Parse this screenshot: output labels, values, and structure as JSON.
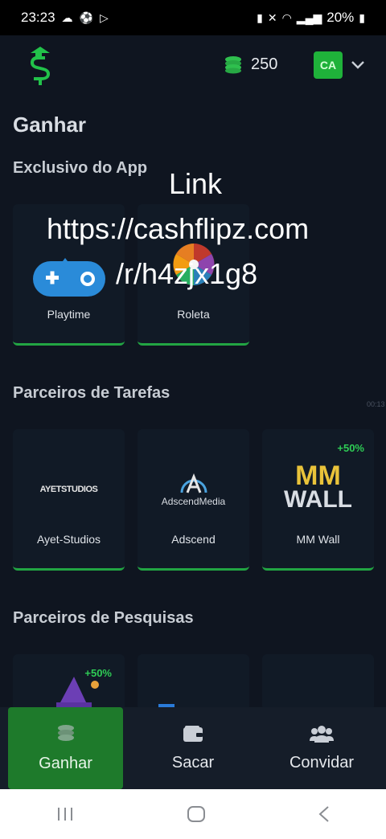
{
  "status_bar": {
    "time": "23:23",
    "battery": "20%"
  },
  "header": {
    "balance": "250",
    "avatar_initials": "CA",
    "colors": {
      "accent": "#1fb23a",
      "background": "#0f1520"
    }
  },
  "page": {
    "title": "Ganhar"
  },
  "sections": {
    "exclusive": {
      "title": "Exclusivo do App",
      "cards": [
        {
          "label": "Playtime"
        },
        {
          "label": "Roleta"
        }
      ]
    },
    "tasks": {
      "title": "Parceiros de Tarefas",
      "cards": [
        {
          "label": "Ayet-Studios",
          "logo_text": "AYETSTUDIOS"
        },
        {
          "label": "Adscend",
          "logo_text": "AdscendMedia"
        },
        {
          "label": "MM Wall",
          "logo_line1": "MM",
          "logo_line2": "WALL",
          "bonus": "+50%"
        }
      ]
    },
    "surveys": {
      "title": "Parceiros de Pesquisas",
      "cards": [
        {
          "bonus": "+50%"
        }
      ]
    }
  },
  "overlay": {
    "link_label": "Link",
    "url_line1": "https://cashflipz.com",
    "url_line2": "/r/h4zjx1g8",
    "timer": "00:13"
  },
  "bottom_nav": {
    "items": [
      {
        "label": "Ganhar",
        "icon": "coins-icon",
        "active": true
      },
      {
        "label": "Sacar",
        "icon": "wallet-icon"
      },
      {
        "label": "Convidar",
        "icon": "users-icon"
      }
    ]
  }
}
